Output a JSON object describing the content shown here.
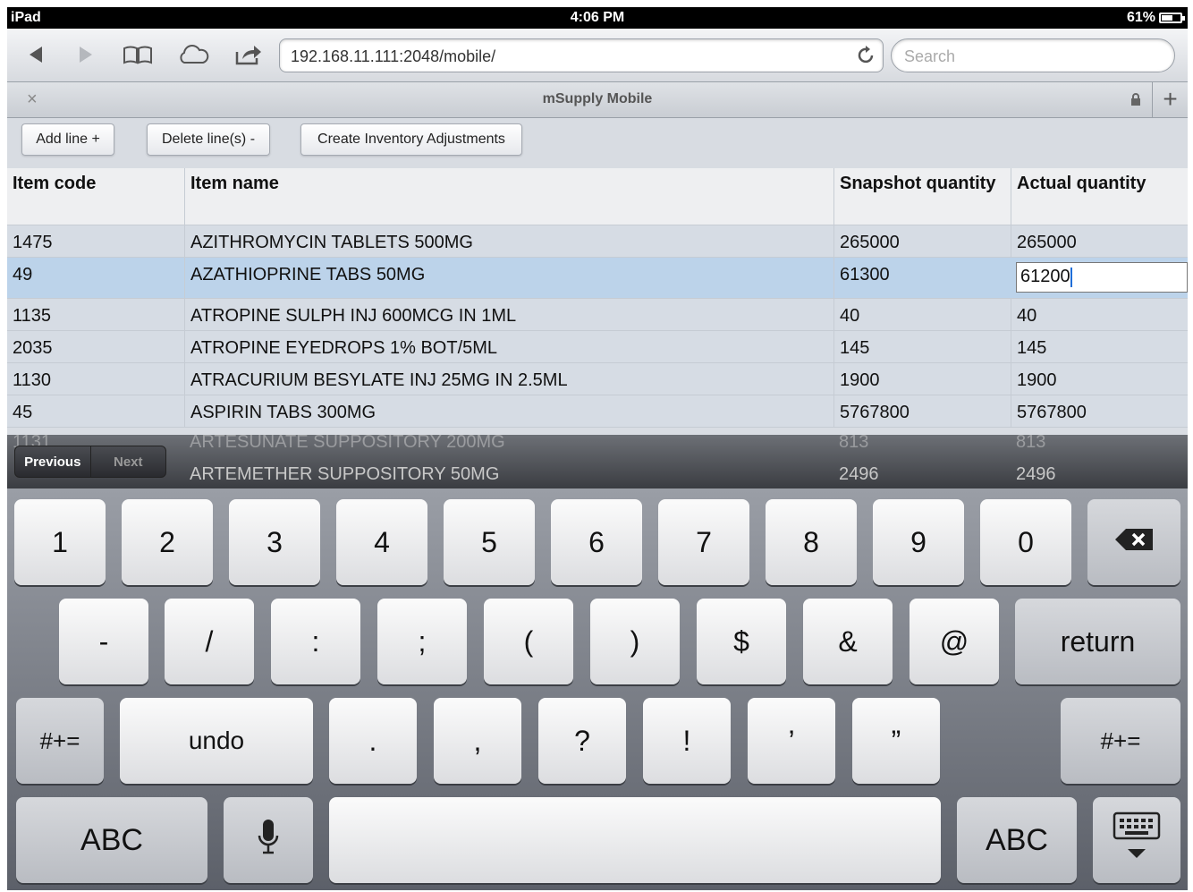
{
  "status_bar": {
    "device": "iPad",
    "time": "4:06 PM",
    "battery": "61%",
    "battery_level": 0.61
  },
  "browser": {
    "url": "192.168.11.111:2048/mobile/",
    "search_placeholder": "Search",
    "tab_title": "mSupply Mobile"
  },
  "actions": {
    "add_line": "Add line +",
    "delete_lines": "Delete line(s) -",
    "create_adjustments": "Create Inventory Adjustments"
  },
  "table": {
    "headers": [
      "Item code",
      "Item name",
      "Snapshot quantity",
      "Actual quantity"
    ],
    "rows": [
      {
        "code": "1475",
        "name": "AZITHROMYCIN TABLETS 500MG",
        "snapshot": "265000",
        "actual": "265000"
      },
      {
        "code": "49",
        "name": "AZATHIOPRINE TABS 50MG",
        "snapshot": "61300",
        "actual": "61200"
      },
      {
        "code": "1135",
        "name": "ATROPINE SULPH INJ 600MCG IN 1ML",
        "snapshot": "40",
        "actual": "40"
      },
      {
        "code": "2035",
        "name": "ATROPINE EYEDROPS 1% BOT/5ML",
        "snapshot": "145",
        "actual": "145"
      },
      {
        "code": "1130",
        "name": "ATRACURIUM BESYLATE INJ 25MG IN 2.5ML",
        "snapshot": "1900",
        "actual": "1900"
      },
      {
        "code": "45",
        "name": "ASPIRIN TABS 300MG",
        "snapshot": "5767800",
        "actual": "5767800"
      }
    ],
    "partially_hidden_rows": [
      {
        "code": "1131",
        "name": "ARTESUNATE SUPPOSITORY 200MG",
        "snapshot": "813",
        "actual": "813"
      },
      {
        "code": "",
        "name": "ARTEMETHER SUPPOSITORY 50MG",
        "snapshot": "2496",
        "actual": "2496"
      }
    ]
  },
  "form_assistant": {
    "previous": "Previous",
    "next": "Next"
  },
  "keyboard": {
    "row1": [
      "1",
      "2",
      "3",
      "4",
      "5",
      "6",
      "7",
      "8",
      "9",
      "0"
    ],
    "row2": [
      "-",
      "/",
      ":",
      ";",
      "(",
      ")",
      "$",
      "&",
      "@"
    ],
    "return": "return",
    "shift_label": "#+=",
    "undo": "undo",
    "row3": [
      ".",
      ",",
      "?",
      "!",
      "’",
      "”"
    ],
    "abc": "ABC"
  },
  "icons": {
    "back": "back-arrow-icon",
    "forward": "forward-arrow-icon",
    "bookmarks": "book-icon",
    "icloud": "cloud-icon",
    "share": "share-icon",
    "reload": "reload-icon",
    "lock": "lock-icon",
    "delete": "backspace-icon",
    "mic": "microphone-icon",
    "hide_keyboard": "keyboard-dismiss-icon"
  }
}
